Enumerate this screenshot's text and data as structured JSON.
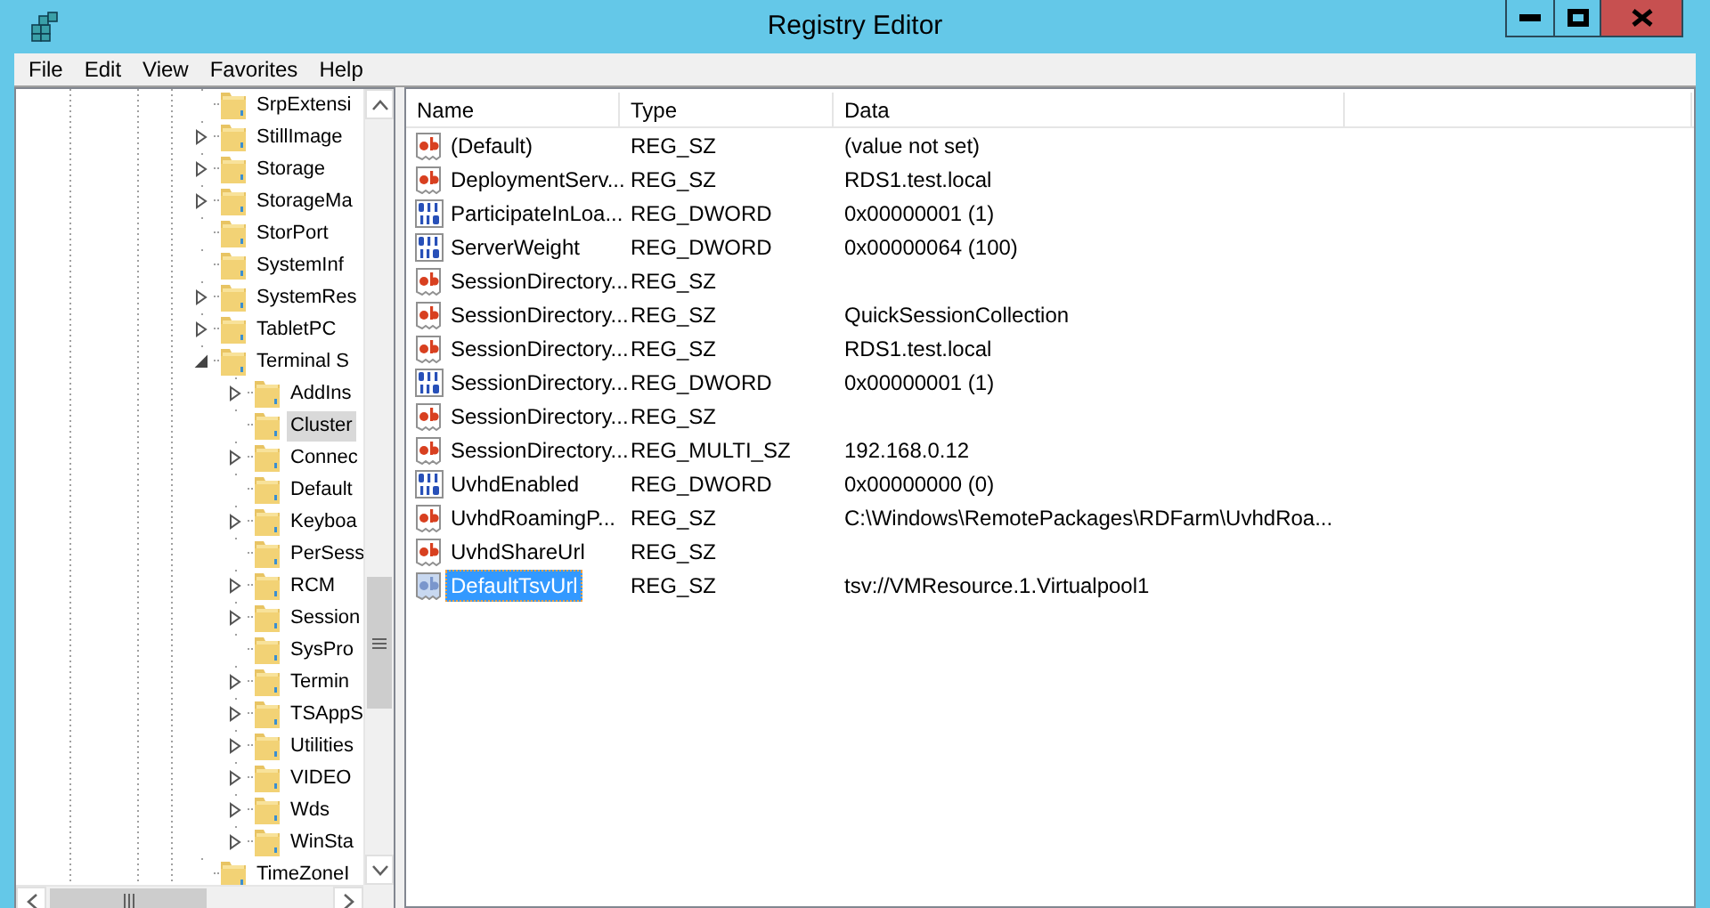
{
  "window": {
    "title": "Registry Editor"
  },
  "menu": [
    "File",
    "Edit",
    "View",
    "Favorites",
    "Help"
  ],
  "tree": [
    {
      "label": "SrpExtensi",
      "kind": "leaf",
      "selected": false
    },
    {
      "label": "StillImage",
      "kind": "node",
      "expanded": false,
      "selected": false
    },
    {
      "label": "Storage",
      "kind": "node",
      "expanded": false,
      "selected": false
    },
    {
      "label": "StorageMa",
      "kind": "node",
      "expanded": false,
      "selected": false
    },
    {
      "label": "StorPort",
      "kind": "leaf",
      "selected": false
    },
    {
      "label": "SystemInf",
      "kind": "leaf",
      "selected": false
    },
    {
      "label": "SystemRes",
      "kind": "node",
      "expanded": false,
      "selected": false
    },
    {
      "label": "TabletPC",
      "kind": "node",
      "expanded": false,
      "selected": false
    },
    {
      "label": "Terminal S",
      "kind": "node",
      "expanded": true,
      "selected": false,
      "children": [
        {
          "label": "AddIns",
          "kind": "node",
          "expanded": false,
          "selected": false
        },
        {
          "label": "Cluster",
          "kind": "leaf",
          "selected": true
        },
        {
          "label": "Connec",
          "kind": "node",
          "expanded": false,
          "selected": false
        },
        {
          "label": "Default",
          "kind": "leaf",
          "selected": false
        },
        {
          "label": "Keyboa",
          "kind": "node",
          "expanded": false,
          "selected": false
        },
        {
          "label": "PerSess",
          "kind": "leaf",
          "selected": false
        },
        {
          "label": "RCM",
          "kind": "node",
          "expanded": false,
          "selected": false
        },
        {
          "label": "Session",
          "kind": "node",
          "expanded": false,
          "selected": false
        },
        {
          "label": "SysPro",
          "kind": "leaf",
          "selected": false
        },
        {
          "label": "Termin",
          "kind": "node",
          "expanded": false,
          "selected": false
        },
        {
          "label": "TSAppS",
          "kind": "node",
          "expanded": false,
          "selected": false
        },
        {
          "label": "Utilities",
          "kind": "node",
          "expanded": false,
          "selected": false
        },
        {
          "label": "VIDEO",
          "kind": "node",
          "expanded": false,
          "selected": false
        },
        {
          "label": "Wds",
          "kind": "node",
          "expanded": false,
          "selected": false
        },
        {
          "label": "WinSta",
          "kind": "node",
          "expanded": false,
          "selected": false
        }
      ]
    },
    {
      "label": "TimeZoneI",
      "kind": "leaf",
      "selected": false
    }
  ],
  "list": {
    "columns": [
      "Name",
      "Type",
      "Data"
    ],
    "rows": [
      {
        "kind": "string",
        "name": "(Default)",
        "type": "REG_SZ",
        "data": "(value not set)",
        "selected": false
      },
      {
        "kind": "string",
        "name": "DeploymentServ...",
        "type": "REG_SZ",
        "data": "RDS1.test.local",
        "selected": false
      },
      {
        "kind": "binary",
        "name": "ParticipateInLoa...",
        "type": "REG_DWORD",
        "data": "0x00000001 (1)",
        "selected": false
      },
      {
        "kind": "binary",
        "name": "ServerWeight",
        "type": "REG_DWORD",
        "data": "0x00000064 (100)",
        "selected": false
      },
      {
        "kind": "string",
        "name": "SessionDirectory...",
        "type": "REG_SZ",
        "selected": false
      },
      {
        "kind": "string",
        "name": "SessionDirectory...",
        "type": "REG_SZ",
        "data": "QuickSessionCollection",
        "selected": false
      },
      {
        "kind": "string",
        "name": "SessionDirectory...",
        "type": "REG_SZ",
        "data": "RDS1.test.local",
        "selected": false
      },
      {
        "kind": "binary",
        "name": "SessionDirectory...",
        "type": "REG_DWORD",
        "data": "0x00000001 (1)",
        "selected": false
      },
      {
        "kind": "string",
        "name": "SessionDirectory...",
        "type": "REG_SZ",
        "selected": false
      },
      {
        "kind": "string",
        "name": "SessionDirectory...",
        "type": "REG_MULTI_SZ",
        "data": "192.168.0.12",
        "selected": false
      },
      {
        "kind": "binary",
        "name": "UvhdEnabled",
        "type": "REG_DWORD",
        "data": "0x00000000 (0)",
        "selected": false
      },
      {
        "kind": "string",
        "name": "UvhdRoamingP...",
        "type": "REG_SZ",
        "data": "C:\\Windows\\RemotePackages\\RDFarm\\UvhdRoa...",
        "selected": false
      },
      {
        "kind": "string",
        "name": "UvhdShareUrl",
        "type": "REG_SZ",
        "selected": false
      },
      {
        "kind": "string",
        "name": "DefaultTsvUrl",
        "type": "REG_SZ",
        "data": "tsv://VMResource.1.Virtualpool1",
        "selected": true
      }
    ]
  }
}
